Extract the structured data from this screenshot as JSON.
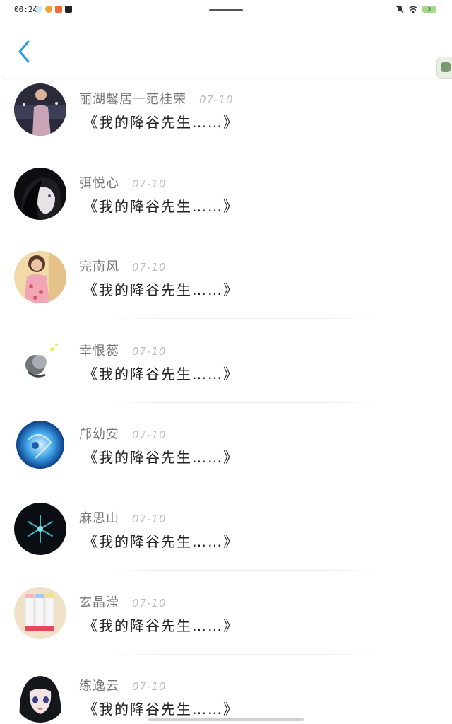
{
  "status_bar": {
    "time": "00:24",
    "battery": "3"
  },
  "list": {
    "items": [
      {
        "name": "丽湖馨居一范桂荣",
        "date": "07-10",
        "message": "《我的降谷先生……》"
      },
      {
        "name": "弭悦心",
        "date": "07-10",
        "message": "《我的降谷先生……》"
      },
      {
        "name": "完南风",
        "date": "07-10",
        "message": "《我的降谷先生……》"
      },
      {
        "name": "幸恨蕊",
        "date": "07-10",
        "message": "《我的降谷先生……》"
      },
      {
        "name": "邝幼安",
        "date": "07-10",
        "message": "《我的降谷先生……》"
      },
      {
        "name": "麻思山",
        "date": "07-10",
        "message": "《我的降谷先生……》"
      },
      {
        "name": "玄晶滢",
        "date": "07-10",
        "message": "《我的降谷先生……》"
      },
      {
        "name": "练逸云",
        "date": "07-10",
        "message": "《我的降谷先生……》"
      }
    ]
  },
  "colors": {
    "accent": "#2a9be0",
    "name": "#777777",
    "date": "#bbbbbb",
    "message": "#222222"
  }
}
